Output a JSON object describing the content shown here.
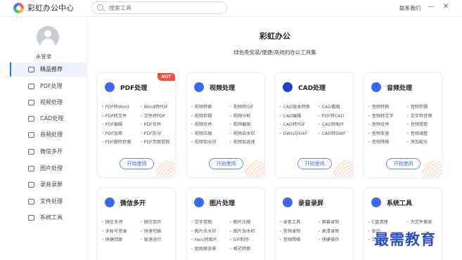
{
  "app": {
    "title": "彩虹办公中心",
    "contact": "联系我们",
    "search_placeholder": "搜索工具",
    "min": "—",
    "close": "✕"
  },
  "user": {
    "name": "未登录"
  },
  "nav": [
    {
      "label": "精品推荐",
      "icon": "thumb-up-icon",
      "active": true
    },
    {
      "label": "PDF处理",
      "icon": "pdf-icon"
    },
    {
      "label": "视频处理",
      "icon": "video-icon"
    },
    {
      "label": "CAD处理",
      "icon": "cad-icon"
    },
    {
      "label": "音频处理",
      "icon": "music-icon"
    },
    {
      "label": "微信多开",
      "icon": "wechat-icon"
    },
    {
      "label": "图片处理",
      "icon": "image-icon"
    },
    {
      "label": "录音录屏",
      "icon": "record-icon"
    },
    {
      "label": "文件处理",
      "icon": "file-icon"
    },
    {
      "label": "系统工具",
      "icon": "system-icon"
    }
  ],
  "main": {
    "title": "彩虹办公",
    "subtitle": "绿色免安装/便捷/高效的办公工具集"
  },
  "cards": [
    {
      "title": "PDF处理",
      "icon": "pdf-icon",
      "color": "#3e66ff",
      "hot": "HOT",
      "btn": "开始使用",
      "features": [
        "PDF转Word",
        "Word转PDF",
        "PDF转文件",
        "文件转PDF",
        "PDF编辑",
        "PDF合并",
        "PDF加密",
        "PDF拆分",
        "PDF删除页面",
        "PDF页面提取"
      ]
    },
    {
      "title": "视频处理",
      "icon": "video-icon",
      "color": "#3e66ff",
      "btn": "开始使用",
      "features": [
        "视频转换",
        "视频转GIF",
        "视频剪辑",
        "视频分割",
        "视频合并",
        "视频截图",
        "视频压缩",
        "视频去水印",
        "视频加水印",
        "视频加减速"
      ]
    },
    {
      "title": "CAD处理",
      "icon": "cad-icon",
      "color": "#1f3fcf",
      "btn": "开始使用",
      "features": [
        "CAD版本转换",
        "CAD看图",
        "CAD编辑",
        "PDF转CAD",
        "CAD转PDF",
        "CAD转图片",
        "DWG与DXF",
        "CAD转DWF"
      ]
    },
    {
      "title": "音频处理",
      "icon": "music-icon",
      "color": "#3e66ff",
      "btn": "开始使用",
      "features": [
        "音频转换",
        "音频剪辑",
        "音频转文字",
        "文字转音频",
        "音频合并",
        "音频提取",
        "音频变速",
        "音频调整",
        "音频降噪",
        "添加配乐"
      ]
    },
    {
      "title": "微信多开",
      "icon": "wechat-icon",
      "color": "#3e66ff",
      "features": [
        "微信多开",
        "微信双开",
        "多账号登录",
        "快速切换",
        "快捷回复",
        "极速运行"
      ]
    },
    {
      "title": "图片处理",
      "icon": "image-icon",
      "color": "#3e66ff",
      "features": [
        "文字提取",
        "图片压缩",
        "图片去水印",
        "图片加水印",
        "Heic转图片",
        "GIF制作",
        "抠图换背景",
        "格式转换"
      ]
    },
    {
      "title": "录音录屏",
      "icon": "record-icon",
      "color": "#3e66ff",
      "features": [
        "录音工具",
        "屏幕录制",
        "音频录制",
        "高清录制",
        "音频降噪",
        "快捷操作"
      ]
    },
    {
      "title": "系统工具",
      "icon": "system-icon",
      "color": "#3e66ff",
      "features": [
        "C盘清理",
        "大文件搬家",
        "驱动",
        "",
        "文件",
        "..."
      ]
    }
  ],
  "watermark": "最需教育"
}
